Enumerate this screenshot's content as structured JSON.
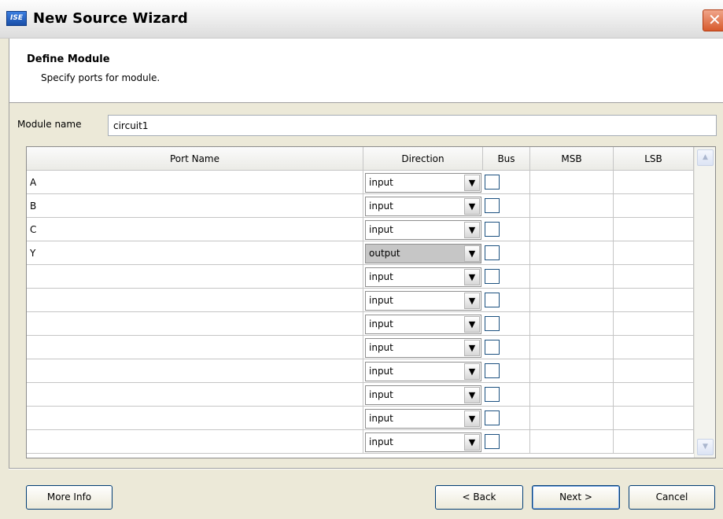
{
  "window": {
    "title": "New Source Wizard",
    "icon": "ise-app-icon",
    "icon_text": "ISE",
    "close_glyph": "✕"
  },
  "header": {
    "title": "Define Module",
    "subtitle": "Specify ports for module."
  },
  "module_name": {
    "label": "Module name",
    "value": "circuit1"
  },
  "table": {
    "columns": [
      "Port Name",
      "Direction",
      "Bus",
      "MSB",
      "LSB"
    ],
    "rows": [
      {
        "name": "A",
        "direction": "input",
        "bus": false,
        "msb": "",
        "lsb": ""
      },
      {
        "name": "B",
        "direction": "input",
        "bus": false,
        "msb": "",
        "lsb": ""
      },
      {
        "name": "C",
        "direction": "input",
        "bus": false,
        "msb": "",
        "lsb": ""
      },
      {
        "name": "Y",
        "direction": "output",
        "bus": false,
        "msb": "",
        "lsb": "",
        "highlighted": true
      },
      {
        "name": "",
        "direction": "input",
        "bus": false,
        "msb": "",
        "lsb": ""
      },
      {
        "name": "",
        "direction": "input",
        "bus": false,
        "msb": "",
        "lsb": ""
      },
      {
        "name": "",
        "direction": "input",
        "bus": false,
        "msb": "",
        "lsb": ""
      },
      {
        "name": "",
        "direction": "input",
        "bus": false,
        "msb": "",
        "lsb": ""
      },
      {
        "name": "",
        "direction": "input",
        "bus": false,
        "msb": "",
        "lsb": ""
      },
      {
        "name": "",
        "direction": "input",
        "bus": false,
        "msb": "",
        "lsb": ""
      },
      {
        "name": "",
        "direction": "input",
        "bus": false,
        "msb": "",
        "lsb": ""
      },
      {
        "name": "",
        "direction": "input",
        "bus": false,
        "msb": "",
        "lsb": ""
      }
    ]
  },
  "buttons": {
    "more_info": "More Info",
    "back": "< Back",
    "next": "Next >",
    "cancel": "Cancel"
  },
  "colors": {
    "window_bg": "#ece9d8",
    "highlight_select": "#c6c6c6",
    "checkbox_border": "#1c5180",
    "close_button": "#d75a2c"
  }
}
